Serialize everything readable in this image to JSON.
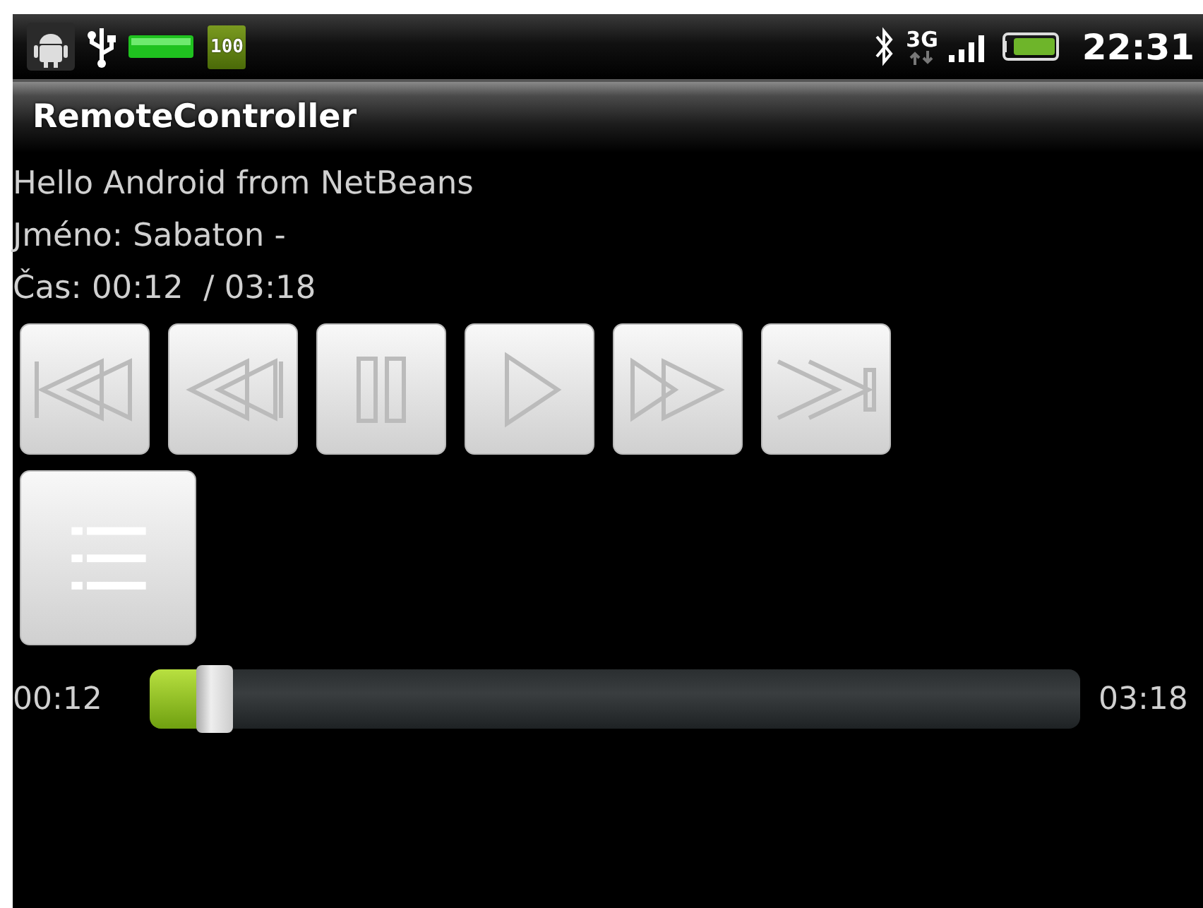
{
  "status_bar": {
    "battery_percent": "100",
    "network": "3G",
    "time": "22:31"
  },
  "title_bar": {
    "title": "RemoteController"
  },
  "info_lines": [
    "Hello Android from NetBeans",
    "Jméno: Sabaton -",
    "Čas: 00:12  / 03:18"
  ],
  "controls": [
    {
      "kind": "first"
    },
    {
      "kind": "rewind"
    },
    {
      "kind": "pause"
    },
    {
      "kind": "play"
    },
    {
      "kind": "forward"
    },
    {
      "kind": "last"
    },
    {
      "kind": "playlist"
    }
  ],
  "seek": {
    "elapsed": "00:12",
    "level": 0.07,
    "total": "03:18"
  }
}
